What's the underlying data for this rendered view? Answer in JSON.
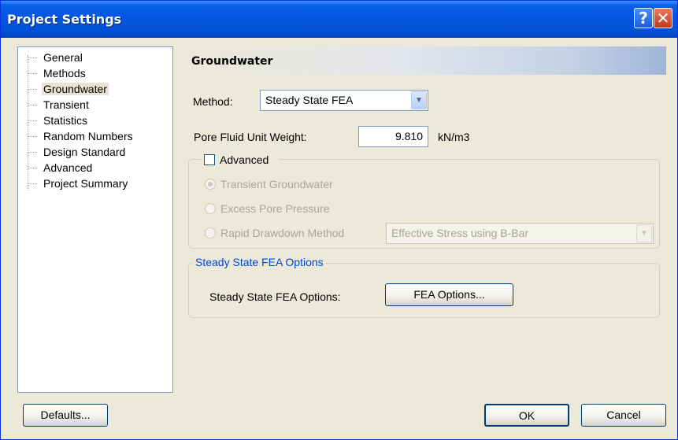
{
  "window": {
    "title": "Project Settings",
    "help_glyph": "?",
    "close_glyph": "✕"
  },
  "nav": {
    "items": [
      {
        "label": "General"
      },
      {
        "label": "Methods"
      },
      {
        "label": "Groundwater",
        "selected": true
      },
      {
        "label": "Transient"
      },
      {
        "label": "Statistics"
      },
      {
        "label": "Random Numbers"
      },
      {
        "label": "Design Standard"
      },
      {
        "label": "Advanced"
      },
      {
        "label": "Project Summary"
      }
    ]
  },
  "panel": {
    "title": "Groundwater",
    "method_label": "Method:",
    "method_value": "Steady State FEA",
    "pore_label": "Pore Fluid Unit Weight:",
    "pore_value": "9.810",
    "pore_unit": "kN/m3",
    "advanced": {
      "label": "Advanced",
      "checked": false,
      "options": [
        {
          "label": "Transient Groundwater",
          "selected": true
        },
        {
          "label": "Excess Pore Pressure",
          "selected": false
        },
        {
          "label": "Rapid Drawdown Method",
          "selected": false
        }
      ],
      "rapid_method_value": "Effective Stress using B-Bar"
    },
    "fea_group": {
      "caption": "Steady State FEA Options",
      "row_label": "Steady State FEA Options:",
      "button_label": "FEA Options..."
    }
  },
  "footer": {
    "defaults_label": "Defaults...",
    "ok_label": "OK",
    "cancel_label": "Cancel"
  },
  "colors": {
    "titlebar": "#0256E0",
    "dialog_bg": "#ECE9D8",
    "group_caption": "#0046D5"
  }
}
